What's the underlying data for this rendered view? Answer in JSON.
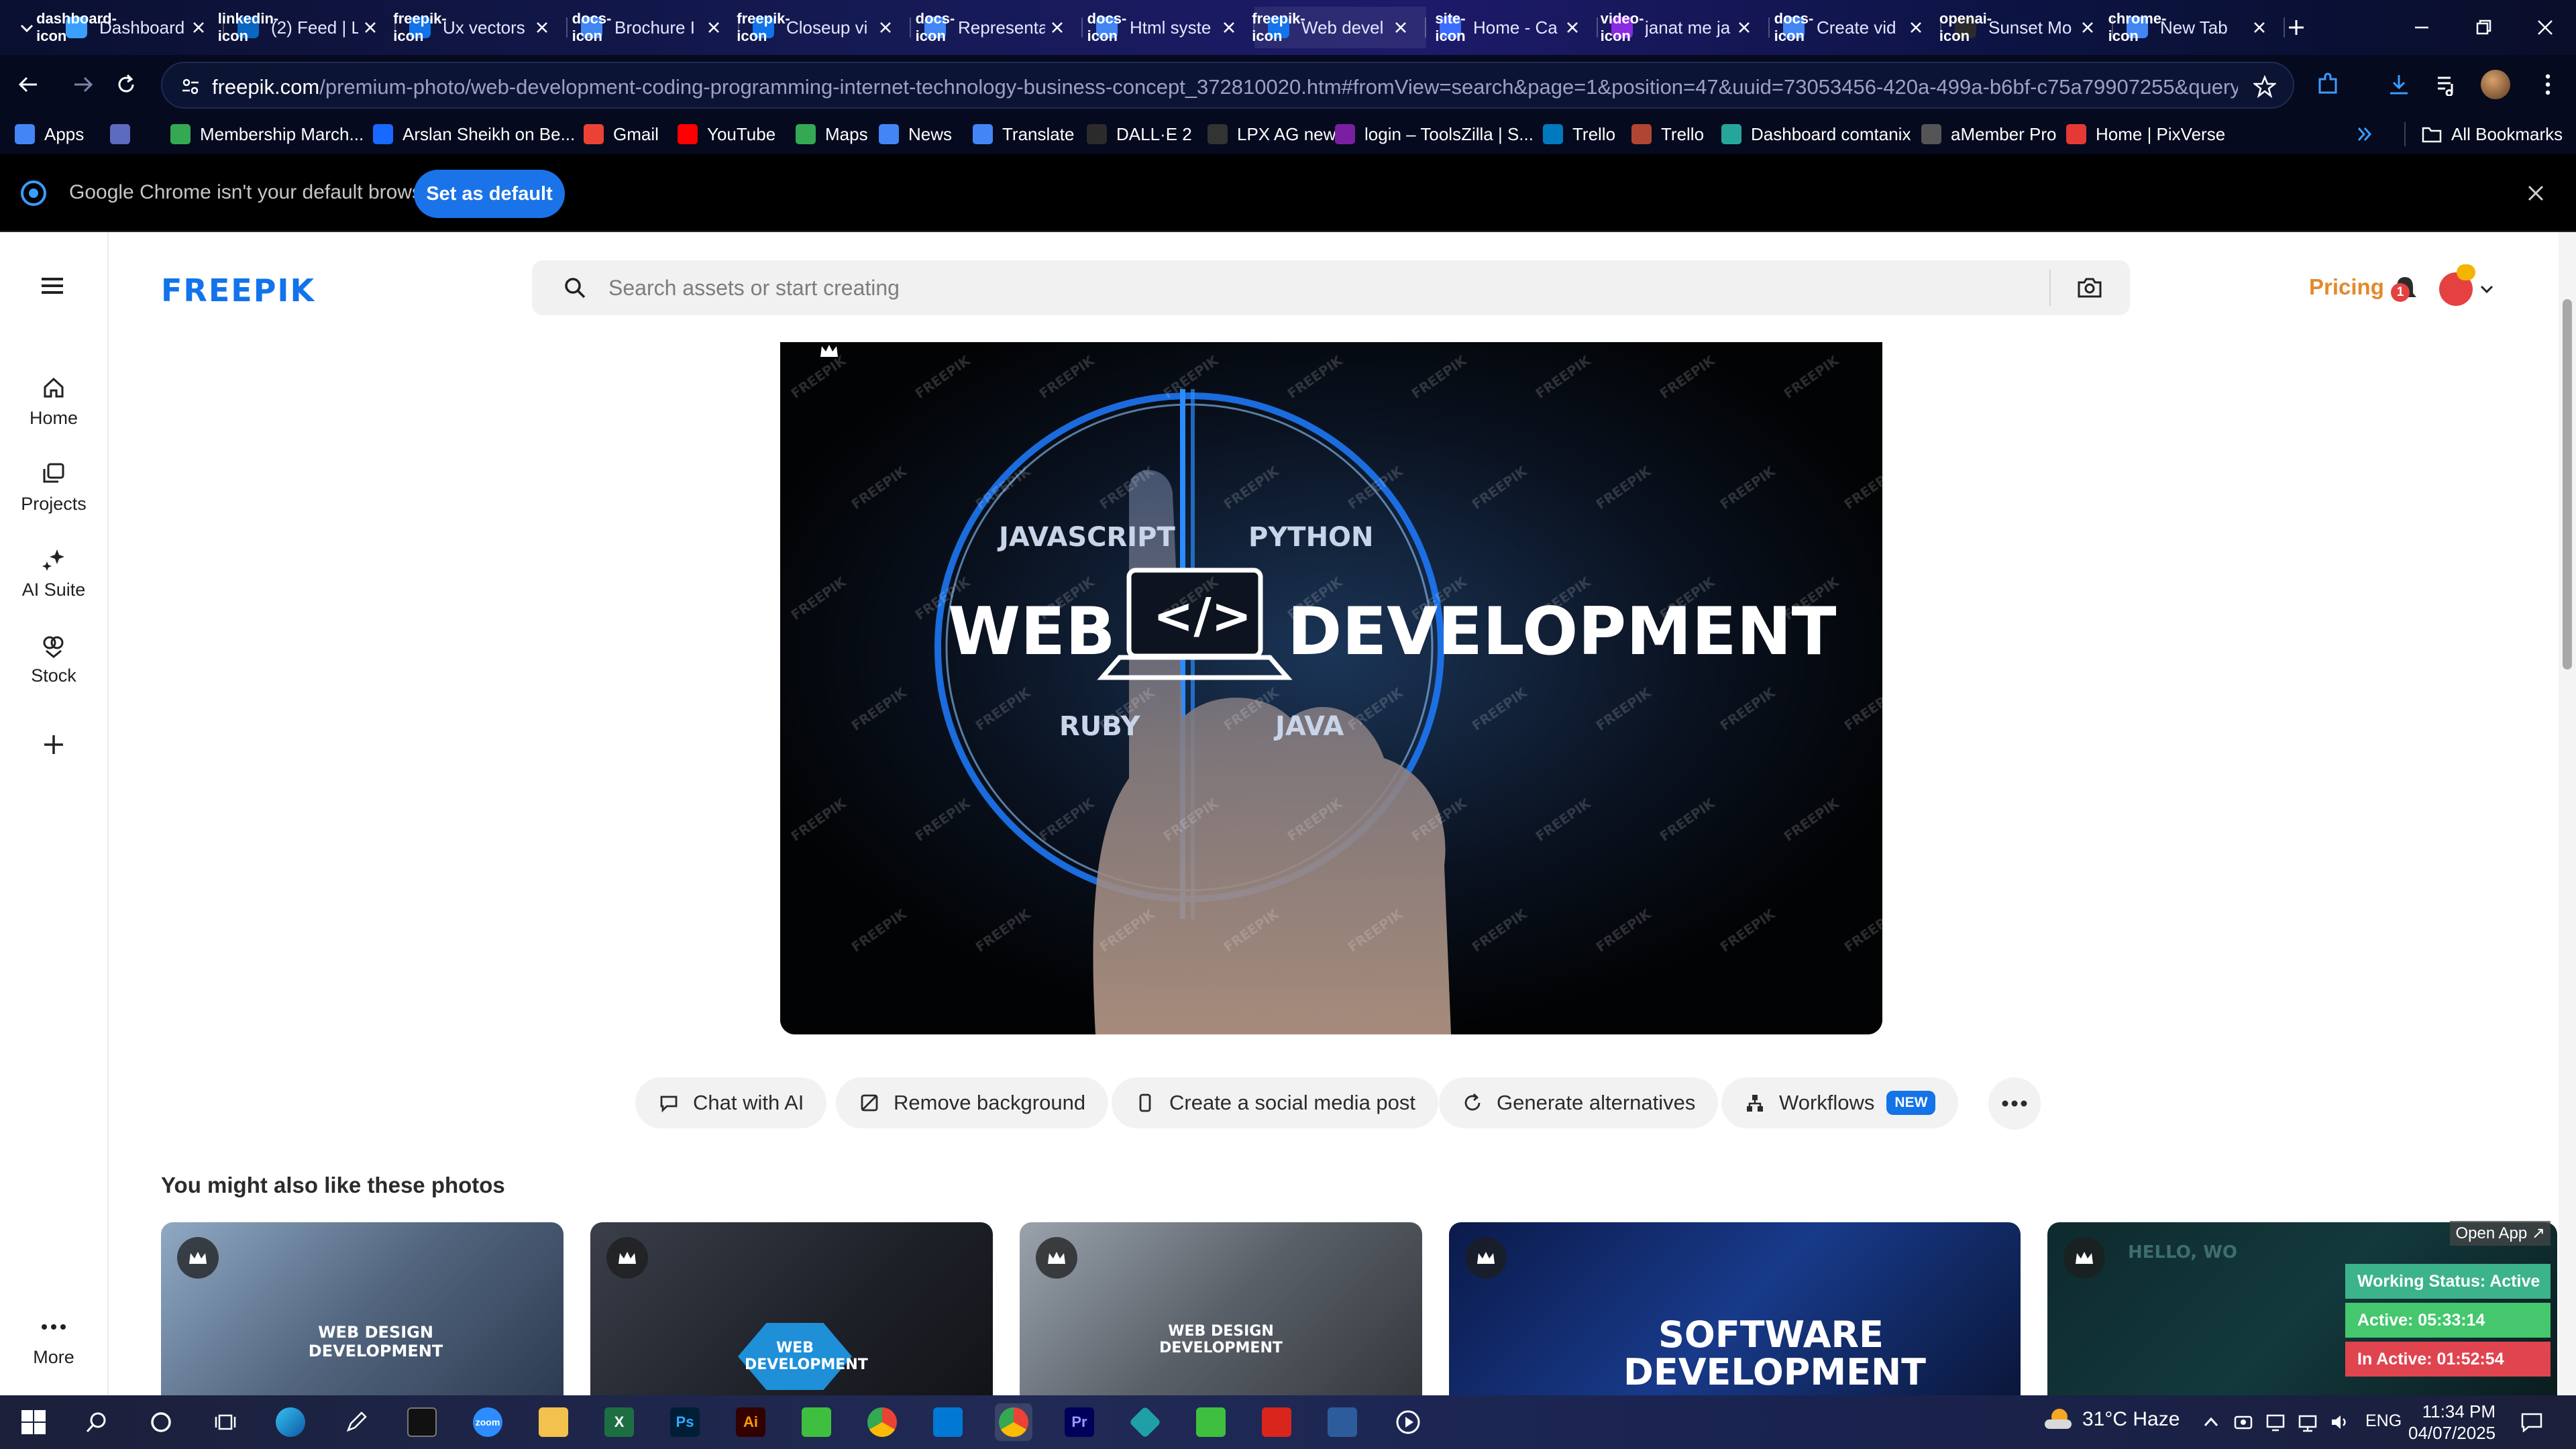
{
  "browser": {
    "tabs": [
      {
        "title": "Dashboard",
        "icon": "dashboard-icon",
        "color": "#3aa0ff"
      },
      {
        "title": "(2) Feed | L",
        "icon": "linkedin-icon",
        "color": "#0a66c2"
      },
      {
        "title": "Ux vectors",
        "icon": "freepik-icon",
        "color": "#1273eb"
      },
      {
        "title": "Brochure I",
        "icon": "docs-icon",
        "color": "#4285f4"
      },
      {
        "title": "Closeup vi",
        "icon": "freepik-icon",
        "color": "#1273eb"
      },
      {
        "title": "Representa",
        "icon": "docs-icon",
        "color": "#4285f4"
      },
      {
        "title": "Html syste",
        "icon": "docs-icon",
        "color": "#4285f4"
      },
      {
        "title": "Web devel",
        "icon": "freepik-icon",
        "color": "#1273eb"
      },
      {
        "title": "Home - Ca",
        "icon": "site-icon",
        "color": "#3c6cff"
      },
      {
        "title": "janat me ja",
        "icon": "video-icon",
        "color": "#8a2be2"
      },
      {
        "title": "Create vid",
        "icon": "docs-icon",
        "color": "#4285f4"
      },
      {
        "title": "Sunset Mo",
        "icon": "openai-icon",
        "color": "#2b2b2b"
      },
      {
        "title": "New Tab",
        "icon": "chrome-icon",
        "color": "#4285f4"
      }
    ],
    "url_host": "freepik.com",
    "url_path": "/premium-photo/web-development-coding-programming-internet-technology-business-concept_372810020.htm#fromView=search&page=1&position=47&uuid=73053456-420a-499a-b6bf-c75a79907255&query=Web+develop...",
    "bookmarks": [
      {
        "label": "Apps",
        "icon": "apps-grid-icon",
        "color": "#4285f4"
      },
      {
        "label": "",
        "icon": "grid-icon",
        "color": "#5c6bc0"
      },
      {
        "label": "Membership March...",
        "icon": "bookmark-icon",
        "color": "#34a853"
      },
      {
        "label": "Arslan Sheikh on Be...",
        "icon": "behance-icon",
        "color": "#1769ff"
      },
      {
        "label": "Gmail",
        "icon": "gmail-icon",
        "color": "#ea4335"
      },
      {
        "label": "YouTube",
        "icon": "youtube-icon",
        "color": "#ff0000"
      },
      {
        "label": "Maps",
        "icon": "maps-icon",
        "color": "#34a853"
      },
      {
        "label": "News",
        "icon": "news-icon",
        "color": "#4285f4"
      },
      {
        "label": "Translate",
        "icon": "translate-icon",
        "color": "#4285f4"
      },
      {
        "label": "DALL·E 2",
        "icon": "openai-icon",
        "color": "#2b2b2b"
      },
      {
        "label": "LPX AG new",
        "icon": "site-icon",
        "color": "#333333"
      },
      {
        "label": "login – ToolsZilla | S...",
        "icon": "toolszilla-icon",
        "color": "#7b1fa2"
      },
      {
        "label": "Trello",
        "icon": "trello-icon",
        "color": "#0079bf"
      },
      {
        "label": "Trello",
        "icon": "trello-icon",
        "color": "#b04632"
      },
      {
        "label": "Dashboard comtanix",
        "icon": "site-icon",
        "color": "#26a69a"
      },
      {
        "label": "aMember Pro",
        "icon": "amember-icon",
        "color": "#555555"
      },
      {
        "label": "Home | PixVerse",
        "icon": "pixverse-icon",
        "color": "#e53935"
      }
    ],
    "all_bookmarks": "All Bookmarks"
  },
  "infobar": {
    "message": "Google Chrome isn't your default browser",
    "button": "Set as default"
  },
  "freepik": {
    "logo": "FREEPIK",
    "search_placeholder": "Search assets or start creating",
    "pricing": "Pricing",
    "notification_count": "1",
    "sidebar": [
      {
        "label": "Home",
        "icon": "home-icon"
      },
      {
        "label": "Projects",
        "icon": "projects-icon"
      },
      {
        "label": "AI Suite",
        "icon": "sparkle-icon"
      },
      {
        "label": "Stock",
        "icon": "stock-icon"
      }
    ],
    "sidebar_more": "More",
    "hero": {
      "left_word": "WEB",
      "right_word": "DEVELOPMENT",
      "code_symbol": "</>",
      "languages": [
        "JAVASCRIPT",
        "PYTHON",
        "RUBY",
        "JAVA"
      ],
      "watermark": "FREEPIK"
    },
    "actions": [
      {
        "label": "Chat with AI",
        "icon": "chat-icon"
      },
      {
        "label": "Remove background",
        "icon": "remove-bg-icon"
      },
      {
        "label": "Create a social media post",
        "icon": "phone-icon"
      },
      {
        "label": "Generate alternatives",
        "icon": "refresh-icon"
      },
      {
        "label": "Workflows",
        "icon": "workflow-icon",
        "badge": "NEW"
      }
    ],
    "also_title": "You might also like these photos",
    "thumbnails": [
      {
        "caption": "WEB DESIGN DEVELOPMENT"
      },
      {
        "caption": "WEB DEVELOPMENT"
      },
      {
        "caption": "WEB DESIGN DEVELOPMENT"
      },
      {
        "caption": "SOFTWARE DEVELOPMENT"
      },
      {
        "caption": "HELLO, WO"
      }
    ]
  },
  "widget": {
    "open_app": "Open App ↗",
    "working_status": "Working Status: Active",
    "active": "Active: 05:33:14",
    "inactive": "In Active: 01:52:54"
  },
  "taskbar": {
    "weather": "31°C Haze",
    "language": "ENG",
    "time": "11:34 PM",
    "date": "04/07/2025"
  }
}
